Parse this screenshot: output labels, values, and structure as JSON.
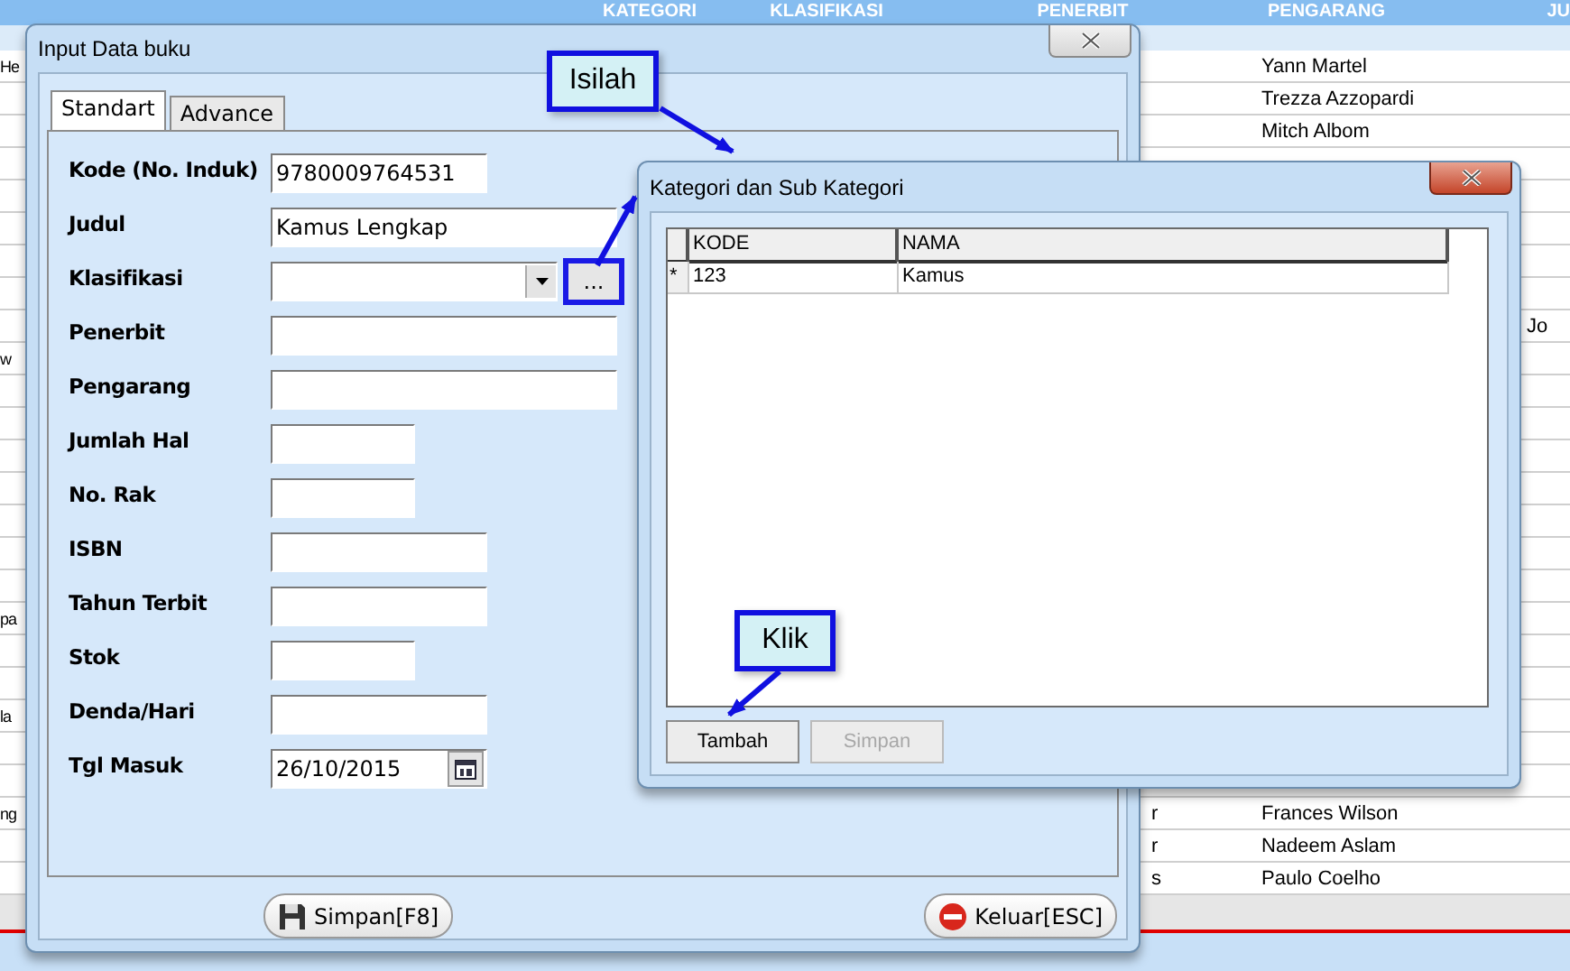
{
  "background_table": {
    "columns": [
      "KATEGORI",
      "KLASIFIKASI",
      "PENERBIT",
      "PENGARANG",
      "JU"
    ],
    "rows": [
      {
        "column_1": "He",
        "pengarang": "Yann Martel"
      },
      {
        "pengarang": "Trezza Azzopardi"
      },
      {
        "pengarang": "Mitch Albom"
      },
      {},
      {},
      {},
      {},
      {},
      {
        "column_8": "Jo"
      },
      {
        "column_1": "w"
      },
      {},
      {},
      {},
      {},
      {},
      {},
      {},
      {
        "column_1": "pa"
      },
      {},
      {},
      {
        "column_1": "la"
      },
      {},
      {},
      {
        "column_1": "ng",
        "column_6": "r",
        "pengarang": "Frances Wilson"
      },
      {
        "column_6": "r",
        "pengarang": "Nadeem Aslam"
      },
      {
        "column_6": "s",
        "pengarang": "Paulo Coelho"
      }
    ]
  },
  "input_dialog": {
    "title": "Input Data buku",
    "tabs": [
      {
        "label": "Standart",
        "selected": true
      },
      {
        "label": "Advance",
        "selected": false
      }
    ],
    "fields": [
      {
        "label": "Kode (No. Induk)",
        "kind": "text",
        "value": "9780009764531"
      },
      {
        "label": "Judul",
        "kind": "text",
        "value": "Kamus Lengkap"
      },
      {
        "label": "Klasifikasi",
        "kind": "combo",
        "lookup_button": {
          "label": "...",
          "highlighted": true
        }
      },
      {
        "label": "Penerbit",
        "kind": "text"
      },
      {
        "label": "Pengarang",
        "kind": "text"
      },
      {
        "label": "Jumlah Hal",
        "kind": "text"
      },
      {
        "label": "No. Rak",
        "kind": "text"
      },
      {
        "label": "ISBN",
        "kind": "text"
      },
      {
        "label": "Tahun Terbit",
        "kind": "text"
      },
      {
        "label": "Stok",
        "kind": "text"
      },
      {
        "label": "Denda/Hari",
        "kind": "text"
      },
      {
        "label": "Tgl Masuk",
        "kind": "date",
        "value": "26/10/2015"
      }
    ],
    "buttons": [
      {
        "label": "Simpan[F8]",
        "kind": "save"
      },
      {
        "label": "Keluar[ESC]",
        "kind": "exit"
      }
    ]
  },
  "category_dialog": {
    "title": "Kategori dan Sub Kategori",
    "columns": [
      "KODE",
      "NAMA"
    ],
    "rows": [
      {
        "indicator": "*",
        "kode": "123",
        "nama": "Kamus"
      }
    ],
    "buttons": [
      {
        "label": "Tambah",
        "disabled": false
      },
      {
        "label": "Simpan",
        "disabled": true
      }
    ]
  },
  "callouts": [
    {
      "text": "Isilah"
    },
    {
      "text": "Klik"
    }
  ]
}
